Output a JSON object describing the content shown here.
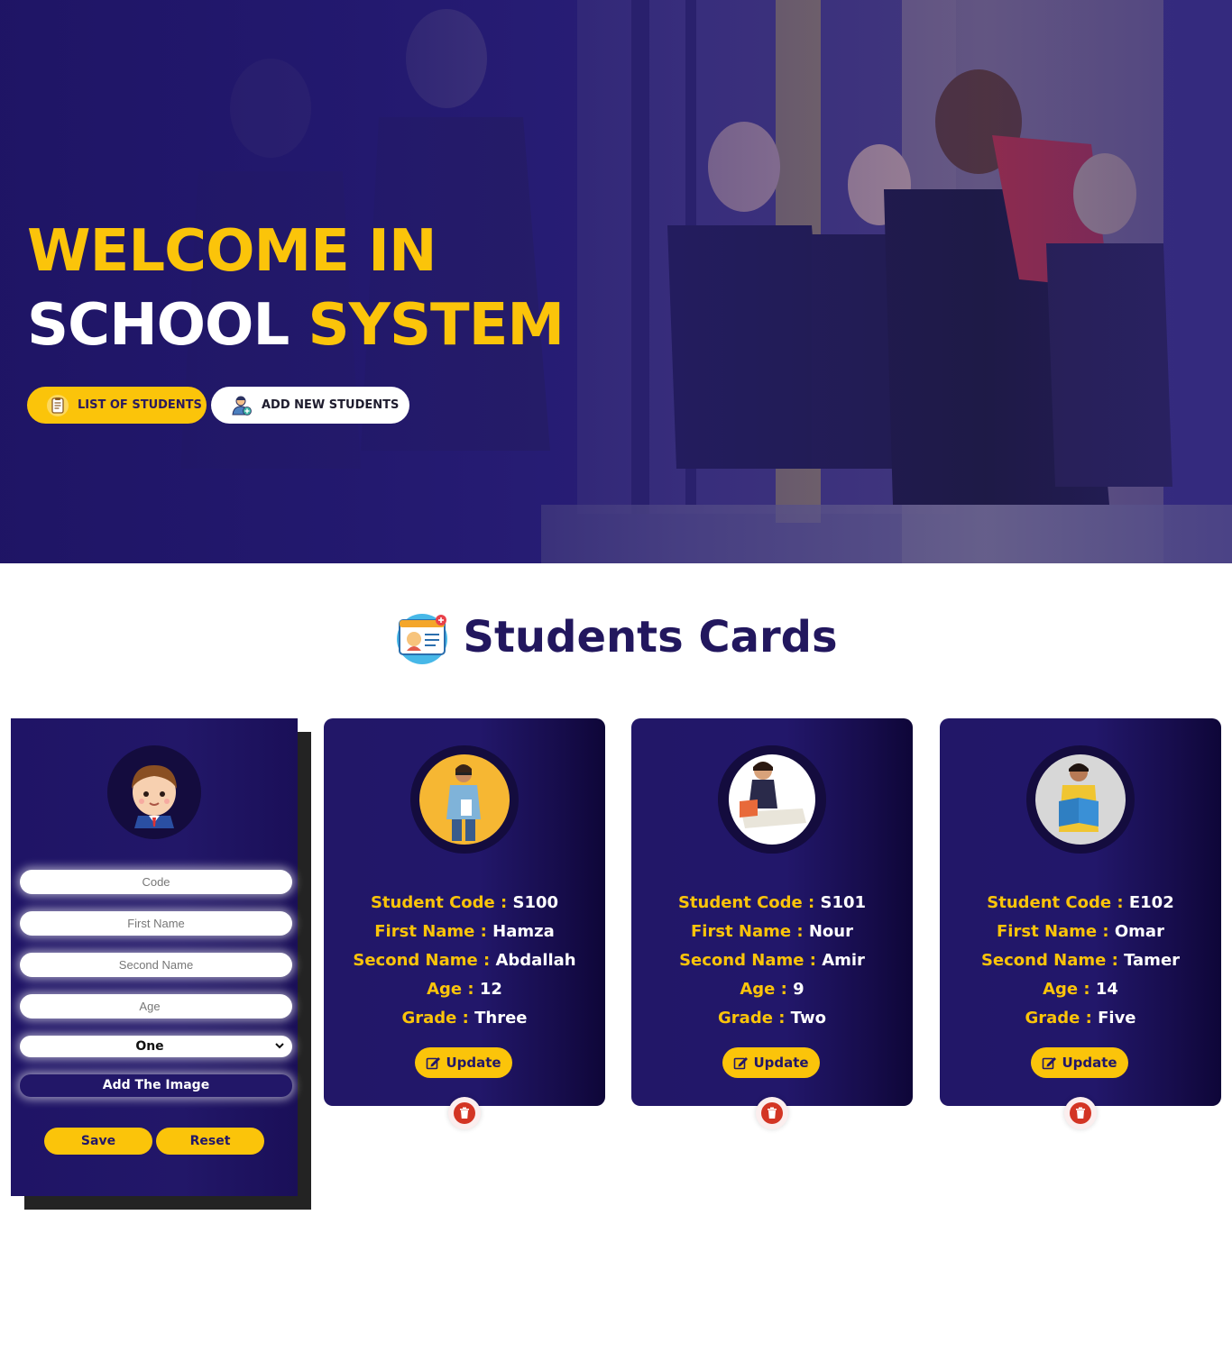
{
  "hero": {
    "title_line1": "WELCOME IN",
    "title_line2_white": "SCHOOL",
    "title_line2_yellow": "SYSTEM",
    "list_button": "LIST OF STUDENTS",
    "add_button": "ADD NEW STUDENTS"
  },
  "section": {
    "title": "Students Cards"
  },
  "form": {
    "code_placeholder": "Code",
    "first_name_placeholder": "First Name",
    "second_name_placeholder": "Second Name",
    "age_placeholder": "Age",
    "grade_selected": "One",
    "image_button": "Add The Image",
    "save_button": "Save",
    "reset_button": "Reset"
  },
  "labels": {
    "code": "Student Code :",
    "first": "First Name :",
    "second": "Second Name :",
    "age": "Age :",
    "grade": "Grade :",
    "update": "Update"
  },
  "students": [
    {
      "code": "S100",
      "first": "Hamza",
      "second": "Abdallah",
      "age": "12",
      "grade": "Three"
    },
    {
      "code": "S101",
      "first": "Nour",
      "second": "Amir",
      "age": "9",
      "grade": "Two"
    },
    {
      "code": "E102",
      "first": "Omar",
      "second": "Tamer",
      "age": "14",
      "grade": "Five"
    }
  ],
  "colors": {
    "accent": "#fbc40a",
    "primary": "#221768",
    "delete": "#d33524"
  }
}
